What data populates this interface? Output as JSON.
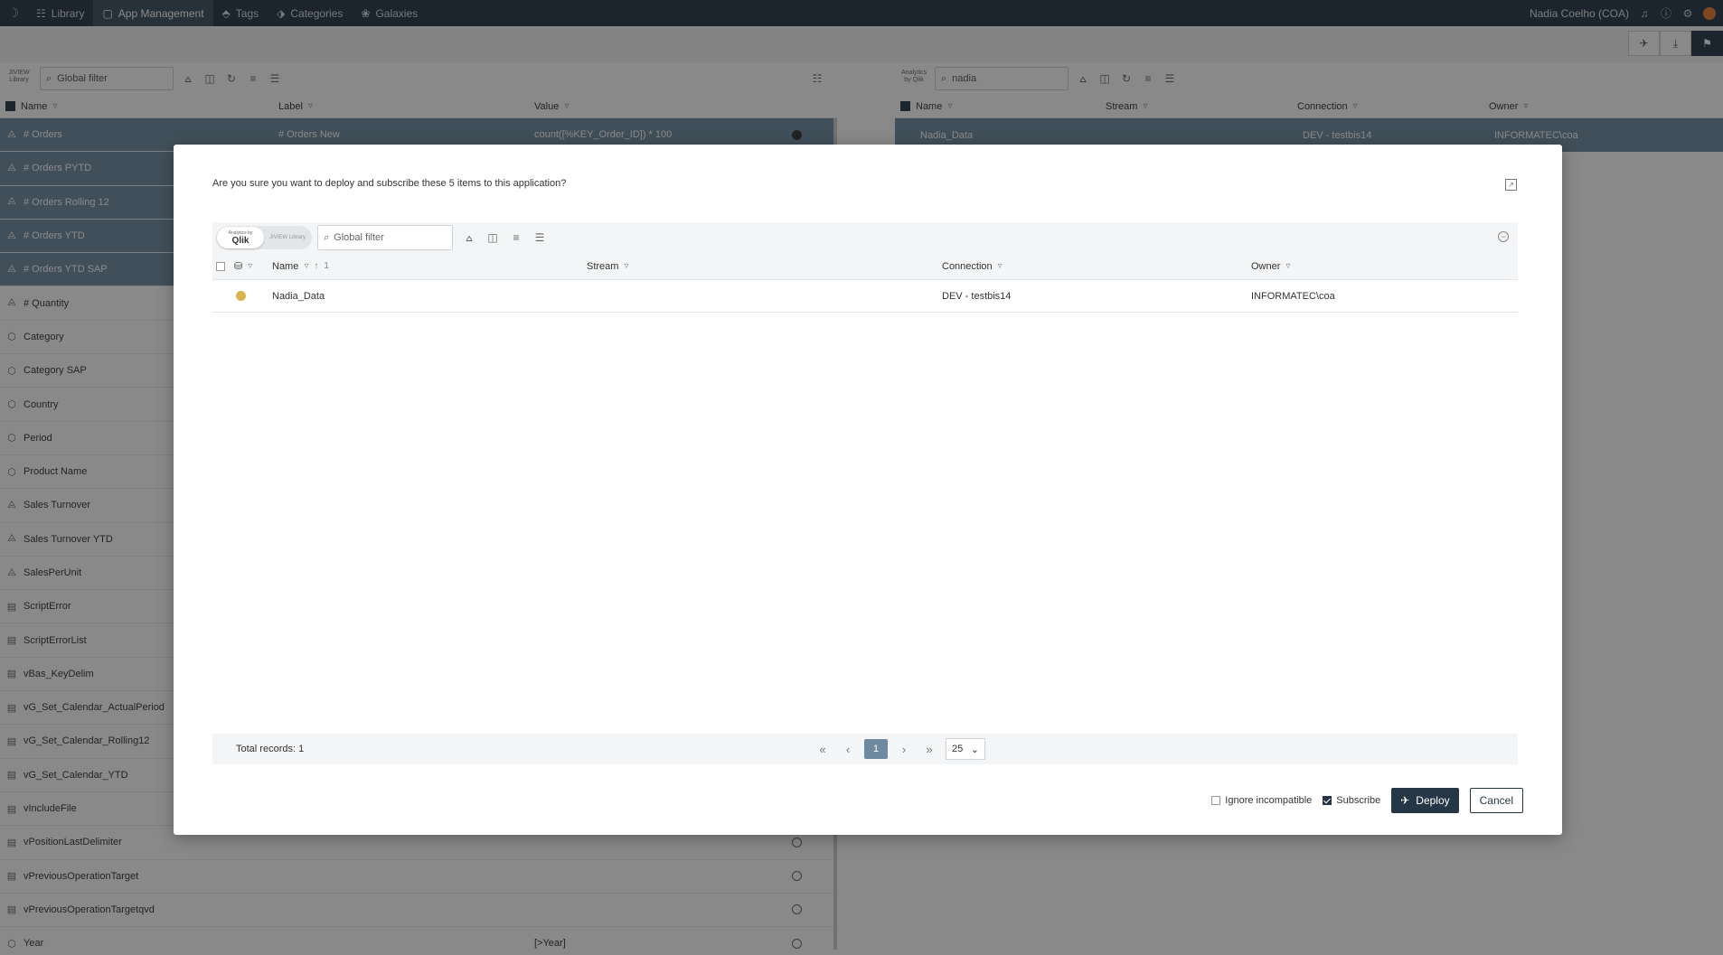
{
  "topnav": {
    "items": [
      {
        "label": "Library",
        "icon": "library-icon"
      },
      {
        "label": "App Management",
        "icon": "app-management-icon"
      },
      {
        "label": "Tags",
        "icon": "tag-icon"
      },
      {
        "label": "Categories",
        "icon": "categories-icon"
      },
      {
        "label": "Galaxies",
        "icon": "galaxy-icon"
      }
    ],
    "active_index": 1,
    "user": "Nadia Coelho (COA)"
  },
  "left_panel": {
    "search_placeholder": "Global filter",
    "mini_logo": "JIVIEW Library",
    "columns": {
      "name": "Name",
      "label": "Label",
      "value": "Value"
    },
    "rows": [
      {
        "name": "# Orders",
        "label": "# Orders New",
        "value": "count([%KEY_Order_ID]) * 100",
        "selected": true,
        "icon": "measure-icon"
      },
      {
        "name": "# Orders PYTD",
        "label": "",
        "value": "",
        "selected": true,
        "icon": "measure-icon"
      },
      {
        "name": "# Orders Rolling 12",
        "label": "",
        "value": "",
        "selected": true,
        "icon": "measure-icon"
      },
      {
        "name": "# Orders YTD",
        "label": "",
        "value": "",
        "selected": true,
        "icon": "measure-icon"
      },
      {
        "name": "# Orders YTD SAP",
        "label": "",
        "value": "",
        "selected": true,
        "icon": "measure-icon"
      },
      {
        "name": "# Quantity",
        "label": "",
        "value": "",
        "selected": false,
        "icon": "measure-icon"
      },
      {
        "name": "Category",
        "label": "",
        "value": "",
        "selected": false,
        "icon": "dimension-icon"
      },
      {
        "name": "Category SAP",
        "label": "",
        "value": "",
        "selected": false,
        "icon": "dimension-icon"
      },
      {
        "name": "Country",
        "label": "",
        "value": "",
        "selected": false,
        "icon": "dimension-icon"
      },
      {
        "name": "Period",
        "label": "",
        "value": "",
        "selected": false,
        "icon": "dimension-icon"
      },
      {
        "name": "Product Name",
        "label": "",
        "value": "",
        "selected": false,
        "icon": "dimension-icon"
      },
      {
        "name": "Sales Turnover",
        "label": "",
        "value": "",
        "selected": false,
        "icon": "measure-icon"
      },
      {
        "name": "Sales Turnover YTD",
        "label": "",
        "value": "",
        "selected": false,
        "icon": "measure-icon"
      },
      {
        "name": "SalesPerUnit",
        "label": "",
        "value": "",
        "selected": false,
        "icon": "measure-icon"
      },
      {
        "name": "ScriptError",
        "label": "",
        "value": "",
        "selected": false,
        "icon": "variable-icon"
      },
      {
        "name": "ScriptErrorList",
        "label": "",
        "value": "",
        "selected": false,
        "icon": "variable-icon"
      },
      {
        "name": "vBas_KeyDelim",
        "label": "",
        "value": "",
        "selected": false,
        "icon": "variable-icon"
      },
      {
        "name": "vG_Set_Calendar_ActualPeriod",
        "label": "",
        "value": "",
        "selected": false,
        "icon": "variable-icon"
      },
      {
        "name": "vG_Set_Calendar_Rolling12",
        "label": "",
        "value": "",
        "selected": false,
        "icon": "variable-icon"
      },
      {
        "name": "vG_Set_Calendar_YTD",
        "label": "",
        "value": "",
        "selected": false,
        "icon": "variable-icon"
      },
      {
        "name": "vIncludeFile",
        "label": "",
        "value": "",
        "selected": false,
        "icon": "variable-icon"
      },
      {
        "name": "vPositionLastDelimiter",
        "label": "",
        "value": "",
        "selected": false,
        "icon": "variable-icon"
      },
      {
        "name": "vPreviousOperationTarget",
        "label": "",
        "value": "",
        "selected": false,
        "icon": "variable-icon"
      },
      {
        "name": "vPreviousOperationTargetqvd",
        "label": "",
        "value": "",
        "selected": false,
        "icon": "variable-icon"
      },
      {
        "name": "Year",
        "label": "",
        "value": "[>Year]",
        "selected": false,
        "icon": "dimension-icon"
      }
    ]
  },
  "right_panel": {
    "search_value": "nadia",
    "mini_logo": "Analytics by Qlik",
    "columns": {
      "name": "Name",
      "stream": "Stream",
      "connection": "Connection",
      "owner": "Owner"
    },
    "row": {
      "name": "Nadia_Data",
      "stream": "",
      "connection": "DEV - testbis14",
      "owner": "INFORMATEC\\coa"
    }
  },
  "dialog": {
    "title": "Are you sure you want to deploy and subscribe these 5 items to this application?",
    "toggle": {
      "option_a_small": "Analytics by",
      "option_a": "Qlik",
      "option_b": "JIVIEW Library"
    },
    "search_placeholder": "Global filter",
    "columns": {
      "name": "Name",
      "stream": "Stream",
      "connection": "Connection",
      "owner": "Owner"
    },
    "sort_badge": "1",
    "rows": [
      {
        "name": "Nadia_Data",
        "stream": "",
        "connection": "DEV - testbis14",
        "owner": "INFORMATEC\\coa",
        "status_color": "#d9b34f"
      }
    ],
    "footer": {
      "total": "Total records: 1",
      "current_page": "1",
      "page_size": "25"
    },
    "actions": {
      "ignore_label": "Ignore incompatible",
      "ignore_checked": false,
      "subscribe_label": "Subscribe",
      "subscribe_checked": true,
      "deploy_label": "Deploy",
      "cancel_label": "Cancel"
    }
  },
  "colors": {
    "nav_bg": "#253746",
    "selected_row": "#6f8aa0",
    "status_dot": "#d9b34f",
    "primary": "#253746"
  }
}
